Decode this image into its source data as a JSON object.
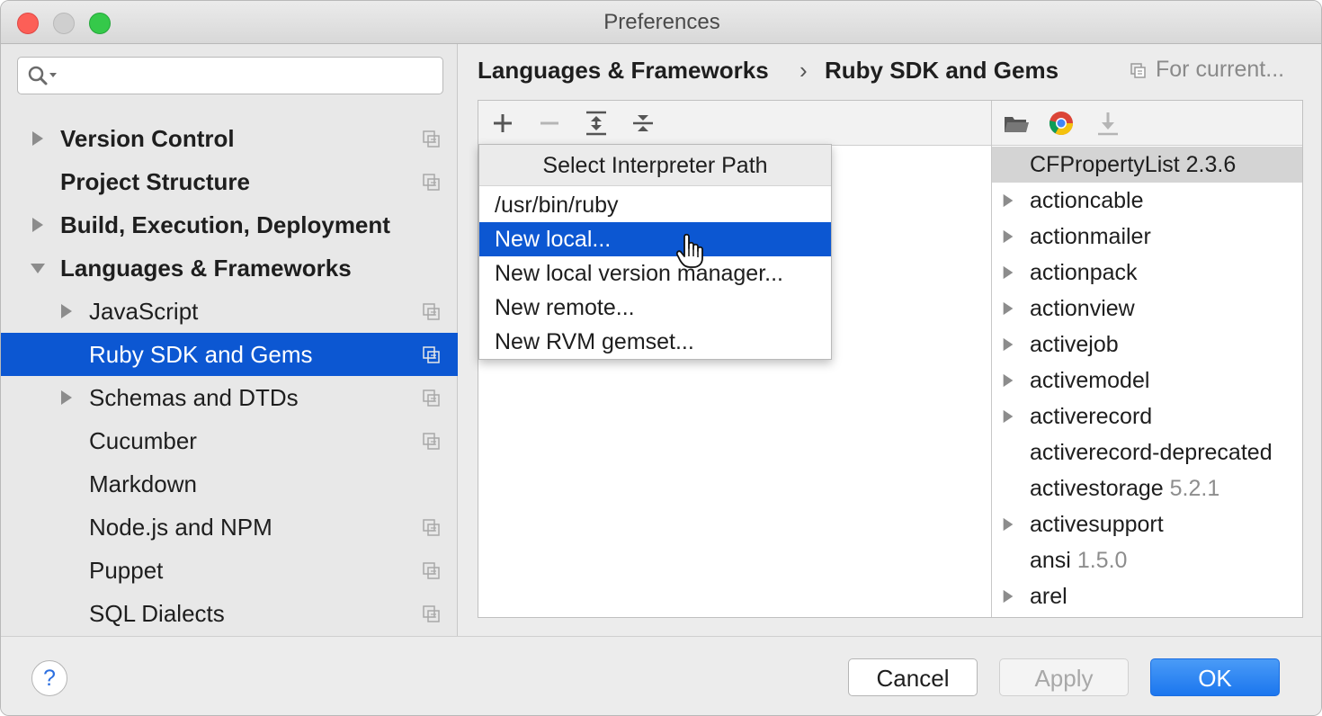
{
  "window": {
    "title": "Preferences"
  },
  "sidebar": {
    "search": {
      "placeholder": ""
    },
    "items": [
      {
        "label": "Version Control",
        "level": 0,
        "expandable": true,
        "expanded": false,
        "bold": true,
        "project_icon": true
      },
      {
        "label": "Project Structure",
        "level": 0,
        "expandable": false,
        "bold": true,
        "project_icon": true
      },
      {
        "label": "Build, Execution, Deployment",
        "level": 0,
        "expandable": true,
        "expanded": false,
        "bold": true,
        "project_icon": false
      },
      {
        "label": "Languages & Frameworks",
        "level": 0,
        "expandable": true,
        "expanded": true,
        "bold": true,
        "project_icon": false
      },
      {
        "label": "JavaScript",
        "level": 1,
        "expandable": true,
        "expanded": false,
        "bold": false,
        "project_icon": true
      },
      {
        "label": "Ruby SDK and Gems",
        "level": 1,
        "expandable": false,
        "bold": false,
        "project_icon": true,
        "selected": true
      },
      {
        "label": "Schemas and DTDs",
        "level": 1,
        "expandable": true,
        "expanded": false,
        "bold": false,
        "project_icon": true
      },
      {
        "label": "Cucumber",
        "level": 1,
        "expandable": false,
        "bold": false,
        "project_icon": true
      },
      {
        "label": "Markdown",
        "level": 1,
        "expandable": false,
        "bold": false,
        "project_icon": false
      },
      {
        "label": "Node.js and NPM",
        "level": 1,
        "expandable": false,
        "bold": false,
        "project_icon": true
      },
      {
        "label": "Puppet",
        "level": 1,
        "expandable": false,
        "bold": false,
        "project_icon": true
      },
      {
        "label": "SQL Dialects",
        "level": 1,
        "expandable": false,
        "bold": false,
        "project_icon": true
      }
    ]
  },
  "breadcrumb": {
    "parent": "Languages & Frameworks",
    "separator": "›",
    "current": "Ruby SDK and Gems"
  },
  "scope": {
    "label": "For current..."
  },
  "toolbar": {
    "left_icons": [
      "add-icon",
      "remove-icon",
      "expand-all-icon",
      "collapse-all-icon"
    ],
    "right_icons": [
      "folder-icon",
      "chrome-icon",
      "download-icon"
    ]
  },
  "popup": {
    "title": "Select Interpreter Path",
    "items": [
      {
        "label": "/usr/bin/ruby"
      },
      {
        "label": "New local...",
        "selected": true
      },
      {
        "label": "New local version manager..."
      },
      {
        "label": "New remote..."
      },
      {
        "label": "New RVM gemset..."
      }
    ]
  },
  "gems": [
    {
      "name": "CFPropertyList 2.3.6",
      "version": "",
      "expandable": false,
      "selected": true
    },
    {
      "name": "actioncable",
      "version": "",
      "expandable": true
    },
    {
      "name": "actionmailer",
      "version": "",
      "expandable": true
    },
    {
      "name": "actionpack",
      "version": "",
      "expandable": true
    },
    {
      "name": "actionview",
      "version": "",
      "expandable": true
    },
    {
      "name": "activejob",
      "version": "",
      "expandable": true
    },
    {
      "name": "activemodel",
      "version": "",
      "expandable": true
    },
    {
      "name": "activerecord",
      "version": "",
      "expandable": true
    },
    {
      "name": "activerecord-deprecated",
      "version": "",
      "expandable": false
    },
    {
      "name": "activestorage",
      "version": "5.2.1",
      "expandable": false
    },
    {
      "name": "activesupport",
      "version": "",
      "expandable": true
    },
    {
      "name": "ansi",
      "version": "1.5.0",
      "expandable": false
    },
    {
      "name": "arel",
      "version": "",
      "expandable": true
    }
  ],
  "footer": {
    "help_label": "?",
    "cancel_label": "Cancel",
    "apply_label": "Apply",
    "ok_label": "OK"
  },
  "colors": {
    "accent": "#0c57d2",
    "ok_button": "#1b76ee",
    "close": "#fc5f57",
    "zoom": "#35c94a"
  }
}
